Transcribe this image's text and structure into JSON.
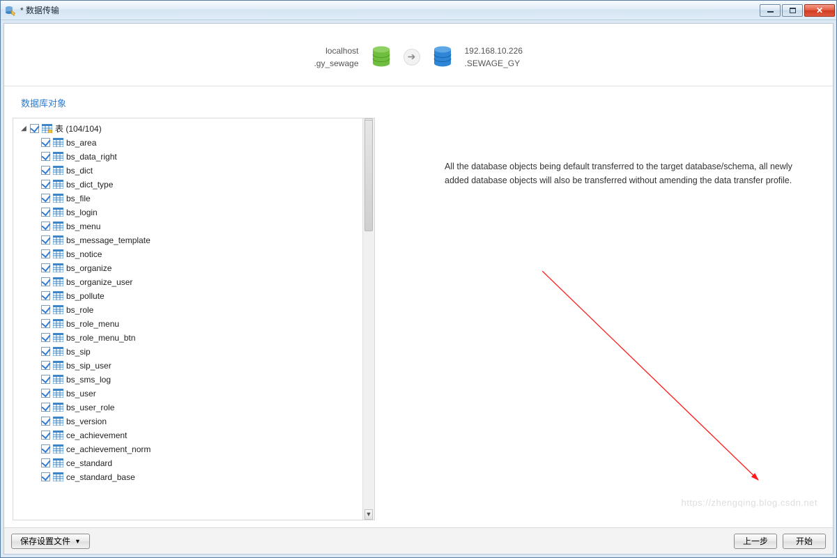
{
  "window": {
    "title": "* 数据传输"
  },
  "header": {
    "source_host": "localhost",
    "source_db": ".gy_sewage",
    "target_host": "192.168.10.226",
    "target_db": ".SEWAGE_GY"
  },
  "section_title": "数据库对象",
  "tree": {
    "root_label": "表  (104/104)",
    "items": [
      "bs_area",
      "bs_data_right",
      "bs_dict",
      "bs_dict_type",
      "bs_file",
      "bs_login",
      "bs_menu",
      "bs_message_template",
      "bs_notice",
      "bs_organize",
      "bs_organize_user",
      "bs_pollute",
      "bs_role",
      "bs_role_menu",
      "bs_role_menu_btn",
      "bs_sip",
      "bs_sip_user",
      "bs_sms_log",
      "bs_user",
      "bs_user_role",
      "bs_version",
      "ce_achievement",
      "ce_achievement_norm",
      "ce_standard",
      "ce_standard_base"
    ]
  },
  "info_text": "All the database objects being default transferred to the target database/schema, all newly added database objects will also be transferred without amending the data transfer profile.",
  "footer": {
    "save_profile": "保存设置文件",
    "prev": "上一步",
    "start": "开始"
  },
  "icons": {
    "arrow": "➔"
  },
  "colors": {
    "accent": "#2f7bd0",
    "green": "#6fbe3f",
    "blue_db": "#2f86d6"
  }
}
